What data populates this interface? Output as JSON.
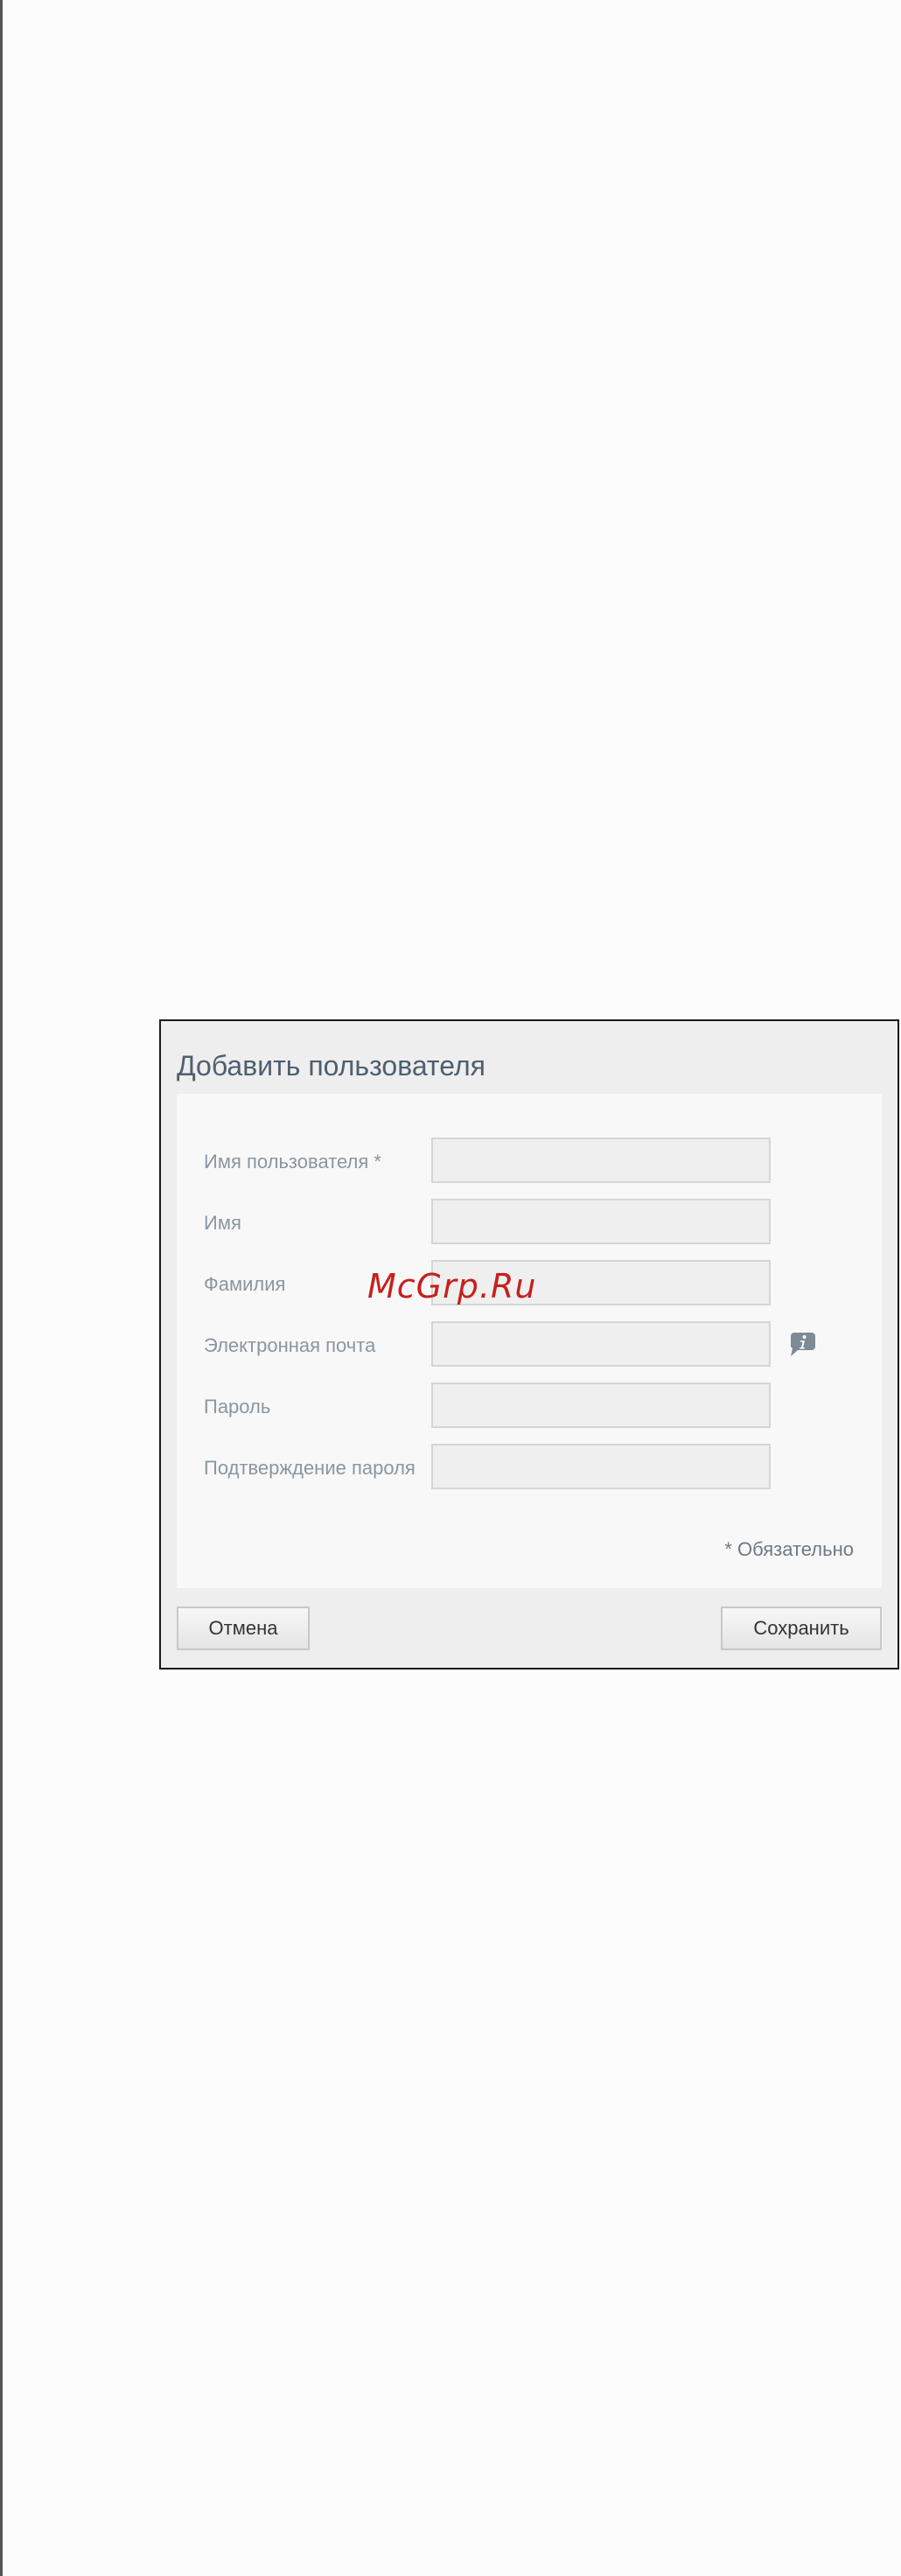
{
  "dialog": {
    "title": "Добавить пользователя",
    "fields": [
      {
        "label": "Имя пользователя *",
        "value": ""
      },
      {
        "label": "Имя",
        "value": ""
      },
      {
        "label": "Фамилия",
        "value": ""
      },
      {
        "label": "Электронная почта",
        "value": ""
      },
      {
        "label": "Пароль",
        "value": ""
      },
      {
        "label": "Подтверждение пароля",
        "value": ""
      }
    ],
    "required_note": "* Обязательно",
    "cancel_label": "Отмена",
    "save_label": "Сохранить",
    "info_icon": "info-icon"
  },
  "watermark": {
    "text": "McGrp.Ru"
  },
  "colors": {
    "page_background": "#fcfcfc",
    "title_text": "#4f5f70",
    "label_text": "#8a96a1",
    "watermark_text": "#c71f1f"
  }
}
